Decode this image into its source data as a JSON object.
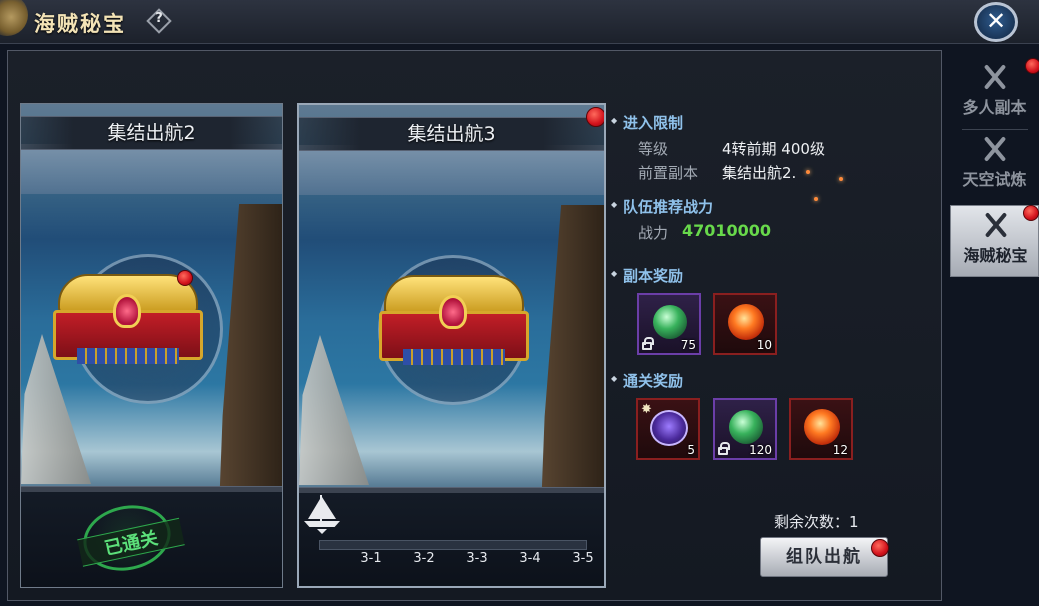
{
  "window": {
    "title": "海贼秘宝",
    "help_symbol": "?",
    "close_symbol": "✕"
  },
  "cards": [
    {
      "title": "集结出航2",
      "status": "已通关",
      "has_reward_dot": true
    },
    {
      "title": "集结出航3",
      "has_reward_dot": true,
      "stages": [
        "3-1",
        "3-2",
        "3-3",
        "3-4",
        "3-5"
      ]
    }
  ],
  "requirements": {
    "header": "进入限制",
    "level_label": "等级",
    "level_value": "4转前期 400级",
    "prereq_label": "前置副本",
    "prereq_value": "集结出航2."
  },
  "power": {
    "header": "队伍推荐战力",
    "label": "战力",
    "value": "47010000",
    "value_color": "#68d94b"
  },
  "dungeon_rewards": {
    "header": "副本奖励",
    "items": [
      {
        "icon": "green-orb-icon",
        "count": "75",
        "locked": true
      },
      {
        "icon": "fire-orb-icon",
        "count": "10",
        "locked": false
      }
    ]
  },
  "clear_rewards": {
    "header": "通关奖励",
    "items": [
      {
        "icon": "rune-icon",
        "count": "5",
        "locked": false
      },
      {
        "icon": "green-orb-icon",
        "count": "120",
        "locked": true
      },
      {
        "icon": "fire-orb-icon",
        "count": "12",
        "locked": false
      }
    ]
  },
  "remaining": "剩余次数：1",
  "action_button": "组队出航",
  "side_tabs": [
    {
      "label": "多人副本",
      "active": false,
      "dot": true
    },
    {
      "label": "天空试炼",
      "active": false,
      "dot": false
    },
    {
      "label": "海贼秘宝",
      "active": true,
      "dot": true
    }
  ],
  "colors": {
    "accent_header": "#8fc1ea",
    "notify_red": "#d2121c"
  }
}
